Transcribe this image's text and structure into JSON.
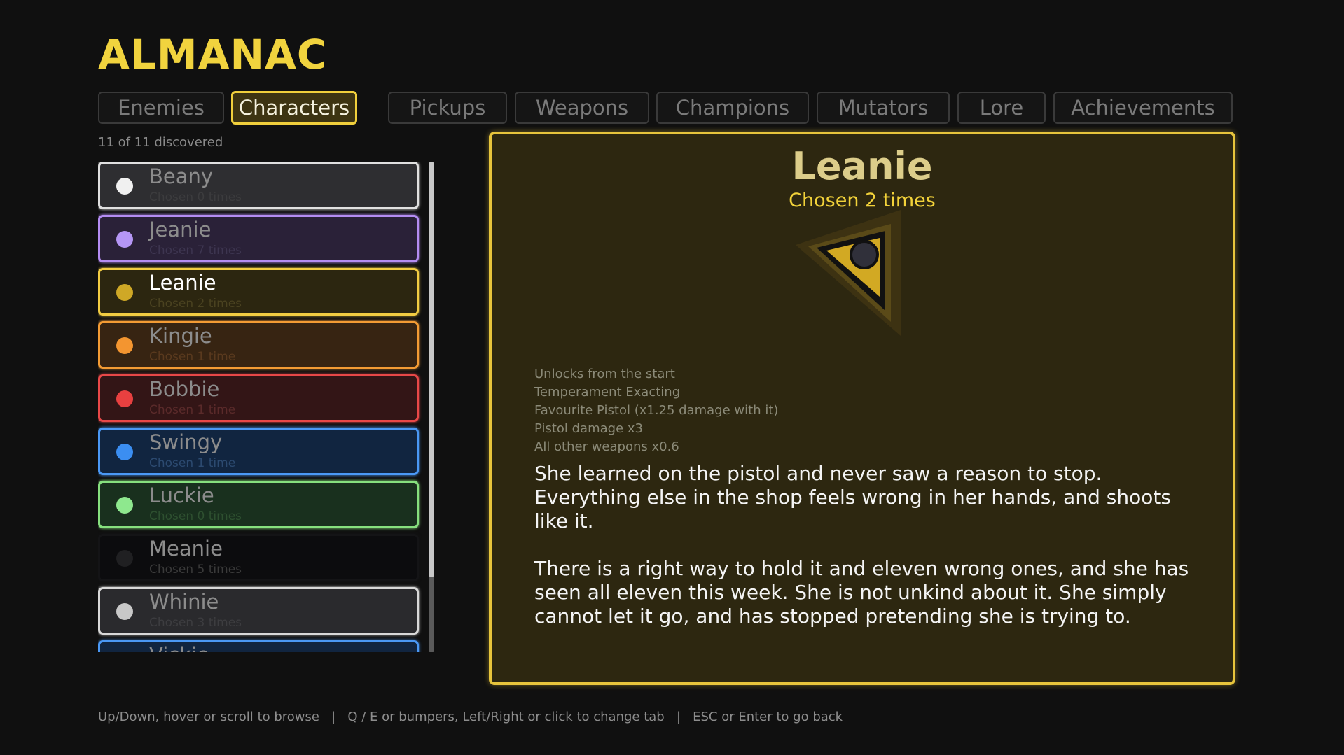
{
  "header": {
    "title": "ALMANAC"
  },
  "tabs": [
    {
      "label": "Enemies",
      "active": false
    },
    {
      "label": "Characters",
      "active": true
    },
    {
      "label": "Pickups",
      "active": false
    },
    {
      "label": "Weapons",
      "active": false
    },
    {
      "label": "Champions",
      "active": false
    },
    {
      "label": "Mutators",
      "active": false
    },
    {
      "label": "Lore",
      "active": false
    },
    {
      "label": "Achievements",
      "active": false
    }
  ],
  "list": {
    "discovered": "11 of 11 discovered",
    "items": [
      {
        "name": "Beany",
        "sub": "Chosen 0 times",
        "color": "#f0f0f0",
        "border": "#e0e0e0",
        "bg": "#2e2e31",
        "subColor": "#3c3c3e"
      },
      {
        "name": "Jeanie",
        "sub": "Chosen 7 times",
        "color": "#b596f5",
        "border": "#b48cf2",
        "bg": "#2a2138",
        "subColor": "#3d3550"
      },
      {
        "name": "Leanie",
        "sub": "Chosen 2 times",
        "color": "#cfa826",
        "border": "#f2cc42",
        "bg": "#2c2610",
        "subColor": "#4a4220",
        "selected": true
      },
      {
        "name": "Kingie",
        "sub": "Chosen 1 time",
        "color": "#f39530",
        "border": "#f39b34",
        "bg": "#372412",
        "subColor": "#5a3a1e"
      },
      {
        "name": "Bobbie",
        "sub": "Chosen 1 time",
        "color": "#e84040",
        "border": "#e84848",
        "bg": "#331516",
        "subColor": "#5a2a2a"
      },
      {
        "name": "Swingy",
        "sub": "Chosen 1 time",
        "color": "#3b8ef1",
        "border": "#4a98f5",
        "bg": "#112540",
        "subColor": "#2c4a70"
      },
      {
        "name": "Luckie",
        "sub": "Chosen 0 times",
        "color": "#8ee88e",
        "border": "#86e07e",
        "bg": "#19301e",
        "subColor": "#2e5030"
      },
      {
        "name": "Meanie",
        "sub": "Chosen 5 times",
        "color": "#202022",
        "border": "#141416",
        "bg": "#0c0c0e",
        "subColor": "#3a3a3a"
      },
      {
        "name": "Whinie",
        "sub": "Chosen 3 times",
        "color": "#c8c8c8",
        "border": "#d8d8d8",
        "bg": "#2a2a2d",
        "subColor": "#3d3d40"
      },
      {
        "name": "Vickie",
        "sub": "",
        "color": "#3b8ef1",
        "border": "#4a98f5",
        "bg": "#112540",
        "subColor": "#2c4a70"
      }
    ]
  },
  "detail": {
    "name": "Leanie",
    "chosen": "Chosen 2 times",
    "stats": [
      "Unlocks  from the start",
      "Temperament  Exacting",
      "Favourite  Pistol  (x1.25 damage with it)",
      "Pistol damage  x3",
      "All other weapons  x0.6"
    ],
    "bio": [
      "She learned on the pistol and never saw a reason to stop. Everything else in the shop feels wrong in her hands, and shoots like it.",
      "There is a right way to hold it and eleven wrong ones, and she has seen all eleven this week. She is not unkind about it. She simply cannot let it go, and has stopped pretending she is trying to."
    ],
    "emblem_icon": "triangle-emblem-icon"
  },
  "footer": {
    "text": "Up/Down, hover or scroll to browse   |   Q / E or bumpers, Left/Right or click to change tab   |   ESC or Enter to go back"
  },
  "colors": {
    "accent": "#f1d33e",
    "panel_bg": "#2d2710",
    "panel_border": "#e7c43c"
  }
}
